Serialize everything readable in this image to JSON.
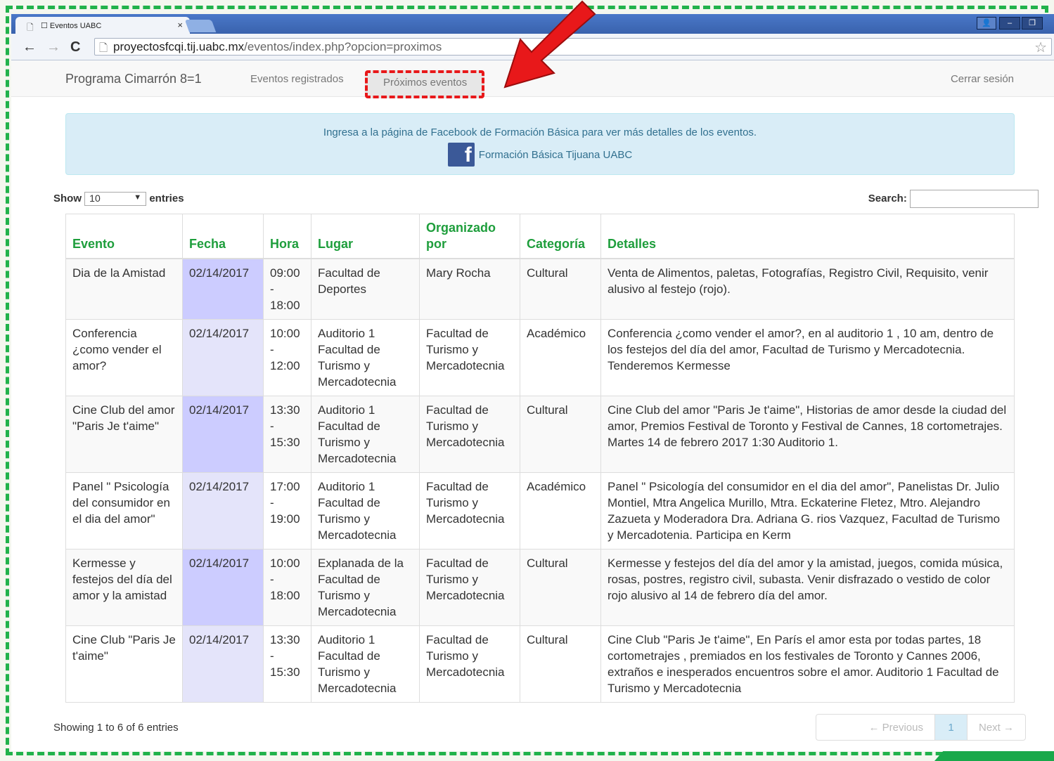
{
  "browser": {
    "tab_title": "☐ Eventos UABC",
    "tab_close": "×",
    "url_domain": "proyectosfcqi.tij.uabc.mx",
    "url_path": "/eventos/index.php?opcion=proximos"
  },
  "navbar": {
    "brand": "Programa Cimarrón 8=1",
    "link_registrados": "Eventos registrados",
    "link_proximos": "Próximos eventos",
    "link_logout": "Cerrar sesión"
  },
  "alert": {
    "message": "Ingresa a la página de Facebook de Formación Básica para ver más detalles de los eventos.",
    "fb_link": "Formación Básica Tijuana UABC"
  },
  "controls": {
    "show_label": "Show",
    "entries_value": "10",
    "entries_label": "entries",
    "search_label": "Search:"
  },
  "table": {
    "headers": [
      "Evento",
      "Fecha",
      "Hora",
      "Lugar",
      "Organizado por",
      "Categoría",
      "Detalles"
    ],
    "rows": [
      {
        "evento": "Dia de la Amistad",
        "fecha": "02/14/2017",
        "hora_inicio": "09:00",
        "hora_sep": "-",
        "hora_fin": "18:00",
        "lugar": "Facultad de Deportes",
        "organizado": "Mary Rocha",
        "categoria": "Cultural",
        "detalles": "Venta de Alimentos, paletas, Fotografías, Registro Civil, Requisito, venir alusivo al festejo (rojo)."
      },
      {
        "evento": "Conferencia ¿como vender el amor?",
        "fecha": "02/14/2017",
        "hora_inicio": "10:00",
        "hora_sep": "-",
        "hora_fin": "12:00",
        "lugar": "Auditorio 1 Facultad de Turismo y Mercadotecnia",
        "organizado": "Facultad de Turismo y Mercadotecnia",
        "categoria": "Académico",
        "detalles": "Conferencia ¿como vender el amor?, en al auditorio 1 , 10 am, dentro de los festejos del día del amor, Facultad de Turismo y Mercadotecnia. Tenderemos Kermesse"
      },
      {
        "evento": "Cine Club del amor \"Paris Je t'aime\"",
        "fecha": "02/14/2017",
        "hora_inicio": "13:30",
        "hora_sep": "-",
        "hora_fin": "15:30",
        "lugar": "Auditorio 1 Facultad de Turismo y Mercadotecnia",
        "organizado": "Facultad de Turismo y Mercadotecnia",
        "categoria": "Cultural",
        "detalles": "Cine Club del amor \"Paris Je t'aime\", Historias de amor desde la ciudad del amor, Premios Festival de Toronto y Festival de Cannes, 18 cortometrajes. Martes 14 de febrero 2017 1:30 Auditorio 1."
      },
      {
        "evento": "Panel \" Psicología del consumidor en el dia del amor\"",
        "fecha": "02/14/2017",
        "hora_inicio": "17:00",
        "hora_sep": "-",
        "hora_fin": "19:00",
        "lugar": "Auditorio 1 Facultad de Turismo y Mercadotecnia",
        "organizado": "Facultad de Turismo y Mercadotecnia",
        "categoria": "Académico",
        "detalles": "Panel \" Psicología del consumidor en el dia del amor\", Panelistas Dr. Julio Montiel, Mtra Angelica Murillo, Mtra. Eckaterine Fletez, Mtro. Alejandro Zazueta y Moderadora Dra. Adriana G. rios Vazquez, Facultad de Turismo y Mercadotenia. Participa en Kerm"
      },
      {
        "evento": "Kermesse y festejos del día del amor y la amistad",
        "fecha": "02/14/2017",
        "hora_inicio": "10:00",
        "hora_sep": "-",
        "hora_fin": "18:00",
        "lugar": "Explanada de la Facultad de Turismo y Mercadotecnia",
        "organizado": "Facultad de Turismo y Mercadotecnia",
        "categoria": "Cultural",
        "detalles": "Kermesse y festejos del día del amor y la amistad, juegos, comida música, rosas, postres, registro civil, subasta. Venir disfrazado o vestido de color rojo alusivo al 14 de febrero día del amor."
      },
      {
        "evento": "Cine Club \"Paris Je t'aime\"",
        "fecha": "02/14/2017",
        "hora_inicio": "13:30",
        "hora_sep": "-",
        "hora_fin": "15:30",
        "lugar": "Auditorio 1 Facultad de Turismo y Mercadotecnia",
        "organizado": "Facultad de Turismo y Mercadotecnia",
        "categoria": "Cultural",
        "detalles": "Cine Club \"Paris Je t'aime\", En París el amor esta por todas partes, 18 cortometrajes , premiados en los festivales de Toronto y Cannes 2006, extraños e inesperados encuentros sobre el amor. Auditorio 1 Facultad de Turismo y Mercadotecnia"
      }
    ]
  },
  "footer": {
    "info": "Showing 1 to 6 of 6 entries",
    "prev": "← Previous",
    "page": "1",
    "next": "Next →"
  },
  "colors": {
    "header_text": "#1e9e3c",
    "frame_border": "#21b24b",
    "highlight_border": "#e8181a",
    "date_column_odd": "#ccccff",
    "date_column_even": "#e4e4fa"
  }
}
